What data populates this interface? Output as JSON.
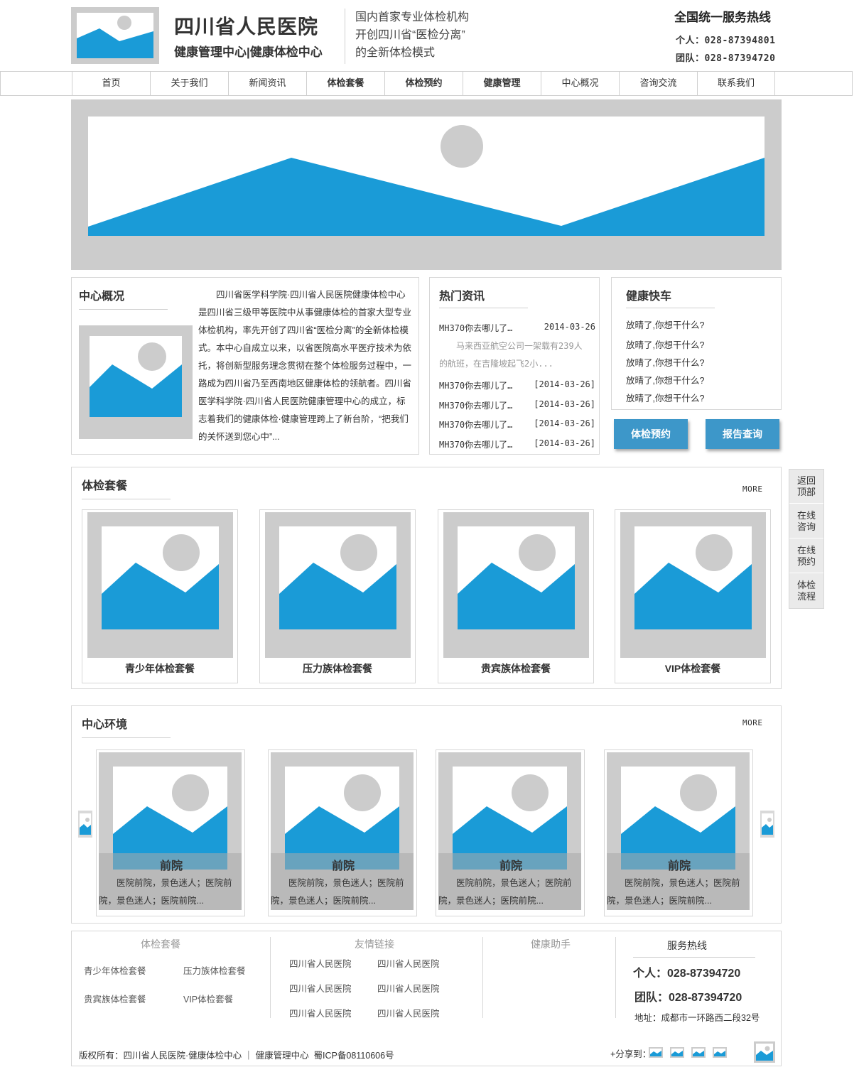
{
  "header": {
    "hospital_name": "四川省人民医院",
    "center_name": "健康管理中心|健康体检中心",
    "slogan": [
      "国内首家专业体检机构",
      "开创四川省“医检分离”",
      "的全新体检模式"
    ],
    "hotline_title": "全国统一服务热线",
    "personal_line": "个人：028-87394801",
    "team_line": "团队：028-87394720"
  },
  "nav": [
    "首页",
    "关于我们",
    "新闻资讯",
    "体检套餐",
    "体检预约",
    "健康管理",
    "中心概况",
    "咨询交流",
    "联系我们"
  ],
  "about": {
    "title": "中心概况",
    "text": "四川省医学科学院·四川省人民医院健康体检中心是四川省三级甲等医院中从事健康体检的首家大型专业体检机构，率先开创了四川省“医检分离”的全新体检模式。本中心自成立以来，以省医院高水平医疗技术为依托，将创新型服务理念贯彻在整个体检服务过程中，一路成为四川省乃至西南地区健康体检的领航者。四川省医学科学院·四川省人民医院健康管理中心的成立，标志着我们的健康体检·健康管理跨上了新台阶，“把我们的关怀送到您心中”..."
  },
  "news": {
    "title": "热门资讯",
    "top_item": {
      "text": "MH370你去哪儿了…",
      "date": "2014-03-26"
    },
    "summary": "马来西亚航空公司一架载有239人的航班，在吉隆坡起飞2小...",
    "items": [
      {
        "text": "MH370你去哪儿了…",
        "date": "[2014-03-26]"
      },
      {
        "text": "MH370你去哪儿了…",
        "date": "[2014-03-26]"
      },
      {
        "text": "MH370你去哪儿了…",
        "date": "[2014-03-26]"
      },
      {
        "text": "MH370你去哪儿了…",
        "date": "[2014-03-26]"
      }
    ]
  },
  "express": {
    "title": "健康快车",
    "items": [
      "放晴了,你想干什么?",
      "放晴了,你想干什么?",
      "放晴了,你想干什么?",
      "放晴了,你想干什么?",
      "放晴了,你想干什么?"
    ]
  },
  "buttons": {
    "booking": "体检预约",
    "report": "报告查询"
  },
  "packages": {
    "title": "体检套餐",
    "more": "MORE",
    "items": [
      "青少年体检套餐",
      "压力族体检套餐",
      "贵宾族体检套餐",
      "VIP体检套餐"
    ]
  },
  "environment": {
    "title": "中心环境",
    "more": "MORE",
    "items": [
      {
        "title": "前院",
        "desc": "医院前院，景色迷人；医院前院，景色迷人；医院前院..."
      },
      {
        "title": "前院",
        "desc": "医院前院，景色迷人；医院前院，景色迷人；医院前院..."
      },
      {
        "title": "前院",
        "desc": "医院前院，景色迷人；医院前院，景色迷人；医院前院..."
      },
      {
        "title": "前院",
        "desc": "医院前院，景色迷人；医院前院，景色迷人；医院前院..."
      }
    ]
  },
  "side_panel": [
    "返回\n顶部",
    "在线\n咨询",
    "在线\n预约",
    "体检\n流程"
  ],
  "footer": {
    "col1": {
      "title": "体检套餐",
      "links": [
        "青少年体检套餐",
        "压力族体检套餐",
        "贵宾族体检套餐",
        "VIP体检套餐"
      ]
    },
    "col2": {
      "title": "友情链接",
      "links": [
        "四川省人民医院",
        "四川省人民医院",
        "四川省人民医院",
        "四川省人民医院",
        "四川省人民医院",
        "四川省人民医院"
      ]
    },
    "col3": {
      "title": "健康助手"
    },
    "col4": {
      "title": "服务热线",
      "personal": "个人：028-87394720",
      "team": "团队：028-87394720",
      "address": "地址：成都市一环路西二段32号"
    },
    "copyright": "版权所有：四川省人民医院·健康体检中心 ｜ 健康管理中心  蜀ICP备08110606号",
    "share_label": "+分享到："
  },
  "colors": {
    "accent": "#1a9bd7",
    "button": "#3d97c9",
    "placeholder": "#cccccc",
    "border": "#d7d7d7"
  }
}
